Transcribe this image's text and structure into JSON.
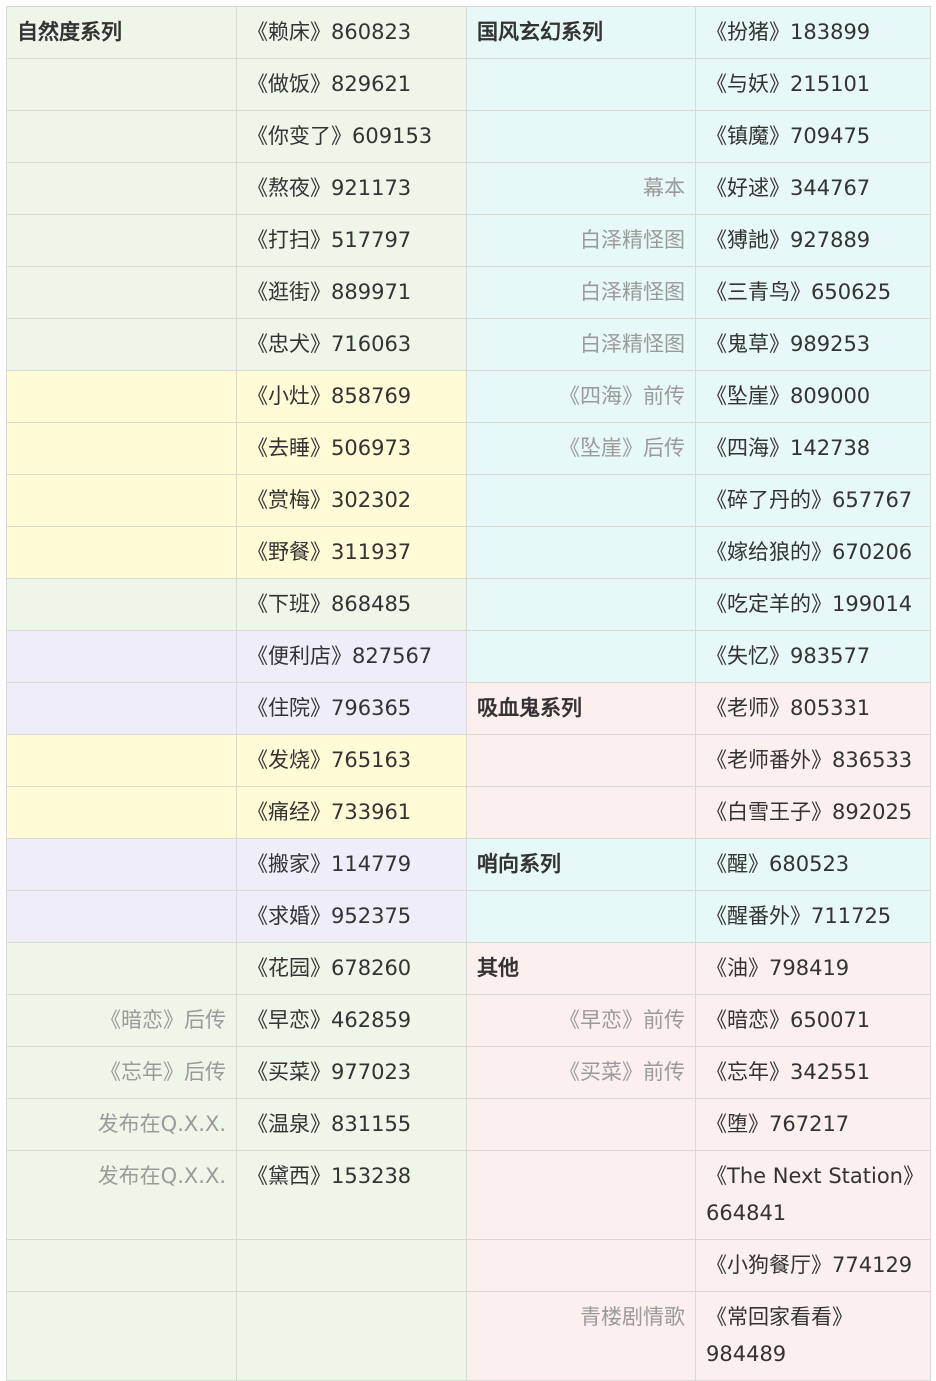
{
  "colors": {
    "green": "#eef6e9",
    "yellow": "#fffbd6",
    "purple": "#efedf8",
    "cyan": "#e6f8f7",
    "pink": "#fcf0ef"
  },
  "rows": [
    {
      "h": 51,
      "c1": {
        "text": "自然度系列",
        "kind": "hdr",
        "bg": "green"
      },
      "c2": {
        "text": "《赖床》860823",
        "bg": "green"
      },
      "c3": {
        "text": "国风玄幻系列",
        "kind": "hdr",
        "bg": "cyan"
      },
      "c4": {
        "text": "《扮猪》183899",
        "bg": "cyan"
      }
    },
    {
      "h": 51,
      "c1": {
        "text": "",
        "bg": "green"
      },
      "c2": {
        "text": "《做饭》829621",
        "bg": "green"
      },
      "c3": {
        "text": "",
        "bg": "cyan"
      },
      "c4": {
        "text": "《与妖》215101",
        "bg": "cyan"
      }
    },
    {
      "h": 51,
      "c1": {
        "text": "",
        "bg": "green"
      },
      "c2": {
        "text": "《你变了》609153",
        "bg": "green"
      },
      "c3": {
        "text": "",
        "bg": "cyan"
      },
      "c4": {
        "text": "《镇魔》709475",
        "bg": "cyan"
      }
    },
    {
      "h": 51,
      "c1": {
        "text": "",
        "bg": "green"
      },
      "c2": {
        "text": "《熬夜》921173",
        "bg": "green"
      },
      "c3": {
        "text": "幕本",
        "kind": "note",
        "bg": "cyan"
      },
      "c4": {
        "text": "《好逑》344767",
        "bg": "cyan"
      }
    },
    {
      "h": 51,
      "c1": {
        "text": "",
        "bg": "green"
      },
      "c2": {
        "text": "《打扫》517797",
        "bg": "green"
      },
      "c3": {
        "text": "白泽精怪图",
        "kind": "note",
        "bg": "cyan"
      },
      "c4": {
        "text": "《猼訑》927889",
        "bg": "cyan"
      }
    },
    {
      "h": 51,
      "c1": {
        "text": "",
        "bg": "green"
      },
      "c2": {
        "text": "《逛街》889971",
        "bg": "green"
      },
      "c3": {
        "text": "白泽精怪图",
        "kind": "note",
        "bg": "cyan"
      },
      "c4": {
        "text": "《三青鸟》650625",
        "bg": "cyan"
      }
    },
    {
      "h": 51,
      "c1": {
        "text": "",
        "bg": "green"
      },
      "c2": {
        "text": "《忠犬》716063",
        "bg": "green"
      },
      "c3": {
        "text": "白泽精怪图",
        "kind": "note",
        "bg": "cyan"
      },
      "c4": {
        "text": "《鬼草》989253",
        "bg": "cyan"
      }
    },
    {
      "h": 51,
      "c1": {
        "text": "",
        "bg": "yellow"
      },
      "c2": {
        "text": "《小灶》858769",
        "bg": "yellow"
      },
      "c3": {
        "text": "《四海》前传",
        "kind": "note",
        "bg": "cyan"
      },
      "c4": {
        "text": "《坠崖》809000",
        "bg": "cyan"
      }
    },
    {
      "h": 51,
      "c1": {
        "text": "",
        "bg": "yellow"
      },
      "c2": {
        "text": "《去睡》506973",
        "bg": "yellow"
      },
      "c3": {
        "text": "《坠崖》后传",
        "kind": "note",
        "bg": "cyan"
      },
      "c4": {
        "text": "《四海》142738",
        "bg": "cyan"
      }
    },
    {
      "h": 51,
      "c1": {
        "text": "",
        "bg": "yellow"
      },
      "c2": {
        "text": "《赏梅》302302",
        "bg": "yellow"
      },
      "c3": {
        "text": "",
        "bg": "cyan"
      },
      "c4": {
        "text": "《碎了丹的》657767",
        "bg": "cyan"
      }
    },
    {
      "h": 51,
      "c1": {
        "text": "",
        "bg": "yellow"
      },
      "c2": {
        "text": "《野餐》311937",
        "bg": "yellow"
      },
      "c3": {
        "text": "",
        "bg": "cyan"
      },
      "c4": {
        "text": "《嫁给狼的》670206",
        "bg": "cyan"
      }
    },
    {
      "h": 51,
      "c1": {
        "text": "",
        "bg": "green"
      },
      "c2": {
        "text": "《下班》868485",
        "bg": "green"
      },
      "c3": {
        "text": "",
        "bg": "cyan"
      },
      "c4": {
        "text": "《吃定羊的》199014",
        "bg": "cyan"
      }
    },
    {
      "h": 51,
      "c1": {
        "text": "",
        "bg": "purple"
      },
      "c2": {
        "text": "《便利店》827567",
        "bg": "purple"
      },
      "c3": {
        "text": "",
        "bg": "cyan"
      },
      "c4": {
        "text": "《失忆》983577",
        "bg": "cyan"
      }
    },
    {
      "h": 51,
      "c1": {
        "text": "",
        "bg": "purple"
      },
      "c2": {
        "text": "《住院》796365",
        "bg": "purple"
      },
      "c3": {
        "text": "吸血鬼系列",
        "kind": "hdr",
        "bg": "pink"
      },
      "c4": {
        "text": "《老师》805331",
        "bg": "pink"
      }
    },
    {
      "h": 51,
      "c1": {
        "text": "",
        "bg": "yellow"
      },
      "c2": {
        "text": "《发烧》765163",
        "bg": "yellow"
      },
      "c3": {
        "text": "",
        "bg": "pink"
      },
      "c4": {
        "text": "《老师番外》836533",
        "bg": "pink"
      }
    },
    {
      "h": 51,
      "c1": {
        "text": "",
        "bg": "yellow"
      },
      "c2": {
        "text": "《痛经》733961",
        "bg": "yellow"
      },
      "c3": {
        "text": "",
        "bg": "pink"
      },
      "c4": {
        "text": "《白雪王子》892025",
        "bg": "pink"
      }
    },
    {
      "h": 51,
      "c1": {
        "text": "",
        "bg": "purple"
      },
      "c2": {
        "text": "《搬家》114779",
        "bg": "purple"
      },
      "c3": {
        "text": "哨向系列",
        "kind": "hdr",
        "bg": "cyan"
      },
      "c4": {
        "text": "《醒》680523",
        "bg": "cyan"
      }
    },
    {
      "h": 51,
      "c1": {
        "text": "",
        "bg": "purple"
      },
      "c2": {
        "text": "《求婚》952375",
        "bg": "purple"
      },
      "c3": {
        "text": "",
        "bg": "cyan"
      },
      "c4": {
        "text": "《醒番外》711725",
        "bg": "cyan"
      }
    },
    {
      "h": 51,
      "c1": {
        "text": "",
        "bg": "green"
      },
      "c2": {
        "text": "《花园》678260",
        "bg": "green"
      },
      "c3": {
        "text": "其他",
        "kind": "hdr",
        "bg": "pink"
      },
      "c4": {
        "text": "《油》798419",
        "bg": "pink"
      }
    },
    {
      "h": 51,
      "c1": {
        "text": "《暗恋》后传",
        "kind": "note",
        "bg": "green"
      },
      "c2": {
        "text": "《早恋》462859",
        "bg": "green"
      },
      "c3": {
        "text": "《早恋》前传",
        "kind": "note",
        "bg": "pink"
      },
      "c4": {
        "text": "《暗恋》650071",
        "bg": "pink"
      }
    },
    {
      "h": 51,
      "c1": {
        "text": "《忘年》后传",
        "kind": "note",
        "bg": "green"
      },
      "c2": {
        "text": "《买菜》977023",
        "bg": "green"
      },
      "c3": {
        "text": "《买菜》前传",
        "kind": "note",
        "bg": "pink"
      },
      "c4": {
        "text": "《忘年》342551",
        "bg": "pink"
      }
    },
    {
      "h": 51,
      "c1": {
        "text": "发布在Q.X.X.",
        "kind": "note",
        "bg": "green"
      },
      "c2": {
        "text": "《温泉》831155",
        "bg": "green"
      },
      "c3": {
        "text": "",
        "bg": "pink"
      },
      "c4": {
        "text": "《堕》767217",
        "bg": "pink"
      }
    },
    {
      "h": 87,
      "c1": {
        "text": "发布在Q.X.X.",
        "kind": "note",
        "bg": "green"
      },
      "c2": {
        "text": "《黛西》153238",
        "bg": "green"
      },
      "c3": {
        "text": "",
        "bg": "pink"
      },
      "c4": {
        "text": "《The Next Station》664841",
        "bg": "pink",
        "wrap": true
      }
    },
    {
      "h": 51,
      "c1": {
        "text": "",
        "bg": "green"
      },
      "c2": {
        "text": "",
        "bg": "green"
      },
      "c3": {
        "text": "",
        "bg": "pink"
      },
      "c4": {
        "text": "《小狗餐厅》774129",
        "bg": "pink"
      }
    },
    {
      "h": 87,
      "c1": {
        "text": "",
        "bg": "green"
      },
      "c2": {
        "text": "",
        "bg": "green"
      },
      "c3": {
        "text": "青楼剧情歌",
        "kind": "note",
        "bg": "pink"
      },
      "c4": {
        "text": "《常回家看看》984489",
        "bg": "pink",
        "wrap": true
      }
    }
  ]
}
